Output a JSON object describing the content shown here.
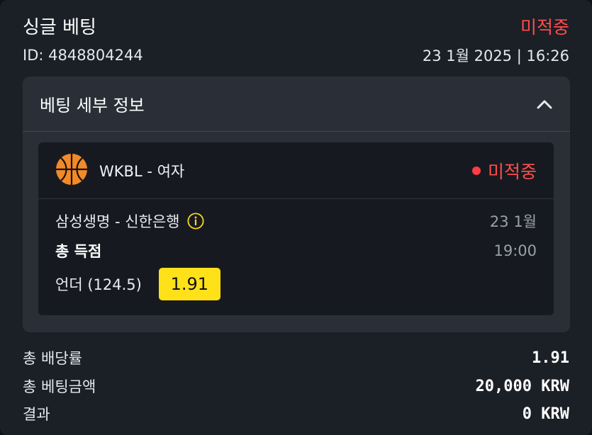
{
  "header": {
    "title": "싱글 베팅",
    "status": "미적중",
    "id_text": "ID: 4848804244",
    "datetime": "23 1월 2025 | 16:26"
  },
  "details": {
    "title": "베팅 세부 정보",
    "toggle_icon": "chevron-up-icon"
  },
  "event": {
    "sport_icon": "basketball-icon",
    "league": "WKBL - 여자",
    "status": "미적중",
    "match": "삼성생명 - 신한은행",
    "date": "23 1월",
    "market": "총 득점",
    "time": "19:00",
    "selection": "언더 (124.5)",
    "odds": "1.91"
  },
  "summary": {
    "total_odds_label": "총 배당률",
    "total_odds_value": "1.91",
    "total_stake_label": "총 베팅금액",
    "total_stake_value": "20,000 KRW",
    "result_label": "결과",
    "result_value": "0 KRW"
  },
  "colors": {
    "status_red": "#ff4d4d",
    "odds_yellow": "#ffe11a",
    "basketball_orange": "#f08a2a"
  }
}
